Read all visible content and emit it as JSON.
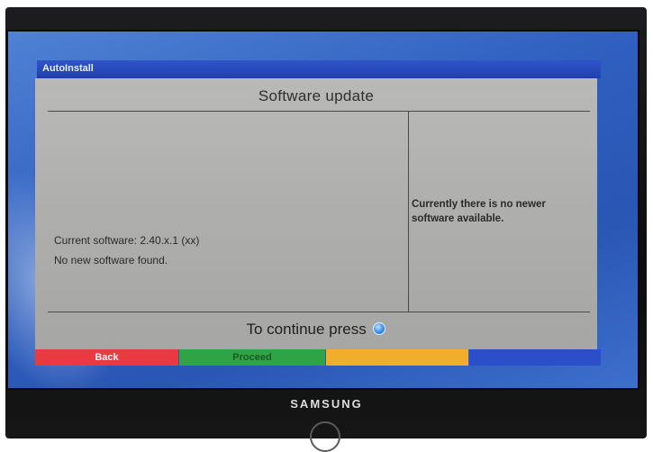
{
  "window": {
    "title": "AutoInstall"
  },
  "dialog": {
    "heading": "Software update",
    "current_software": "Current software: 2.40.x.1 (xx)",
    "status": "No new software found.",
    "right_message": "Currently there is no newer software available.",
    "continue_text": "To continue press",
    "continue_icon": "blue-button-icon"
  },
  "buttons": {
    "red_label": "Back",
    "green_label": "Proceed",
    "yellow_label": "",
    "blue_label": ""
  },
  "brand": "SAMSUNG",
  "colors": {
    "red": "#e83a40",
    "green": "#2ea444",
    "yellow": "#f0ae2c",
    "blue": "#2a4fc8"
  }
}
